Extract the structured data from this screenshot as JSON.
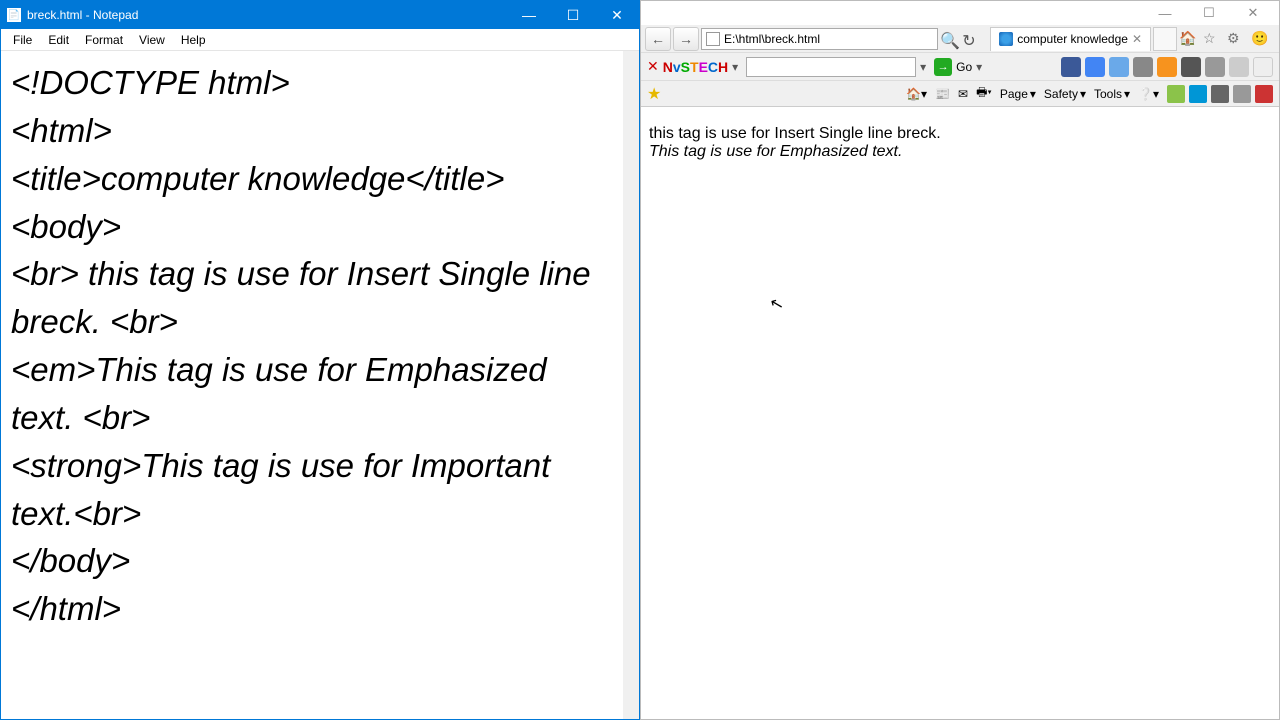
{
  "notepad": {
    "title": "breck.html - Notepad",
    "menu": {
      "file": "File",
      "edit": "Edit",
      "format": "Format",
      "view": "View",
      "help": "Help"
    },
    "content": "<!DOCTYPE html>\n<html>\n<title>computer knowledge</title>\n<body>\n<br> this tag is use for Insert Single line breck. <br>\n<em>This tag is use for Emphasized text. <br>\n<strong>This tag is use for Important text.<br>\n</body>\n</html>"
  },
  "ie": {
    "url": "E:\\html\\breck.html",
    "tab_title": "computer knowledge",
    "go_label": "Go",
    "toolbar2": {
      "page": "Page",
      "safety": "Safety",
      "tools": "Tools"
    },
    "content": {
      "line1": "this tag is use for Insert Single line breck.",
      "line2": "This tag is use for Emphasized text."
    }
  }
}
